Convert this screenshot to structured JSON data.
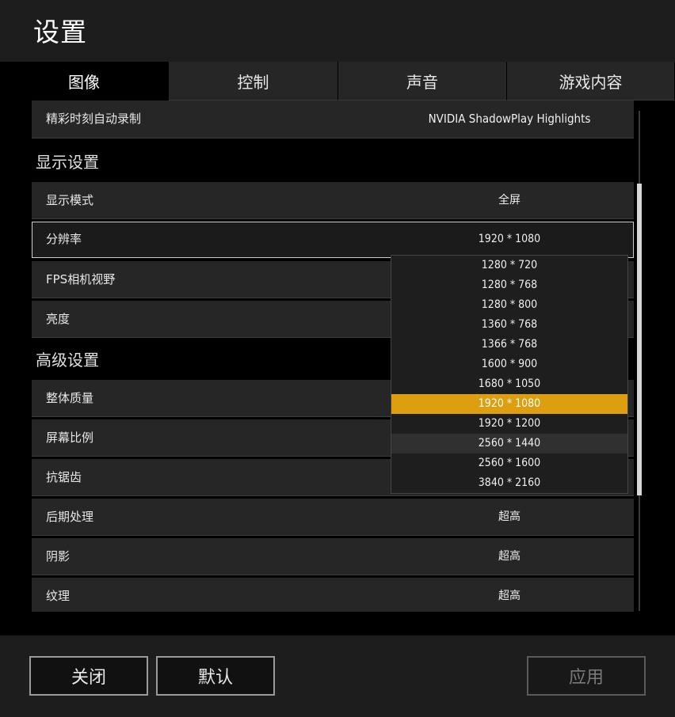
{
  "header": {
    "title": "设置"
  },
  "tabs": [
    {
      "label": "图像",
      "active": true
    },
    {
      "label": "控制"
    },
    {
      "label": "声音"
    },
    {
      "label": "游戏内容"
    }
  ],
  "settings": {
    "highlights": {
      "label": "精彩时刻自动录制",
      "value": "NVIDIA ShadowPlay Highlights"
    },
    "display_section": "显示设置",
    "display_mode": {
      "label": "显示模式",
      "value": "全屏"
    },
    "resolution": {
      "label": "分辨率",
      "value": "1920 * 1080"
    },
    "fps_fov": {
      "label": "FPS相机视野"
    },
    "brightness": {
      "label": "亮度"
    },
    "advanced_section": "高级设置",
    "overall_quality": {
      "label": "整体质量"
    },
    "screen_scale": {
      "label": "屏幕比例"
    },
    "anti_aliasing": {
      "label": "抗锯齿"
    },
    "post_processing": {
      "label": "后期处理",
      "value": "超高"
    },
    "shadows": {
      "label": "阴影",
      "value": "超高"
    },
    "textures": {
      "label": "纹理",
      "value": "超高"
    }
  },
  "resolution_dropdown": {
    "options": [
      "1280 * 720",
      "1280 * 768",
      "1280 * 800",
      "1360 * 768",
      "1366 * 768",
      "1600 * 900",
      "1680 * 1050",
      "1920 * 1080",
      "1920 * 1200",
      "2560 * 1440",
      "2560 * 1600",
      "3840 * 2160"
    ],
    "selected": "1920 * 1080",
    "hovered": "2560 * 1440"
  },
  "footer": {
    "close_label": "关闭",
    "default_label": "默认",
    "apply_label": "应用"
  },
  "colors": {
    "accent": "#dd9f10",
    "background": "#000000",
    "panel": "#262626"
  }
}
